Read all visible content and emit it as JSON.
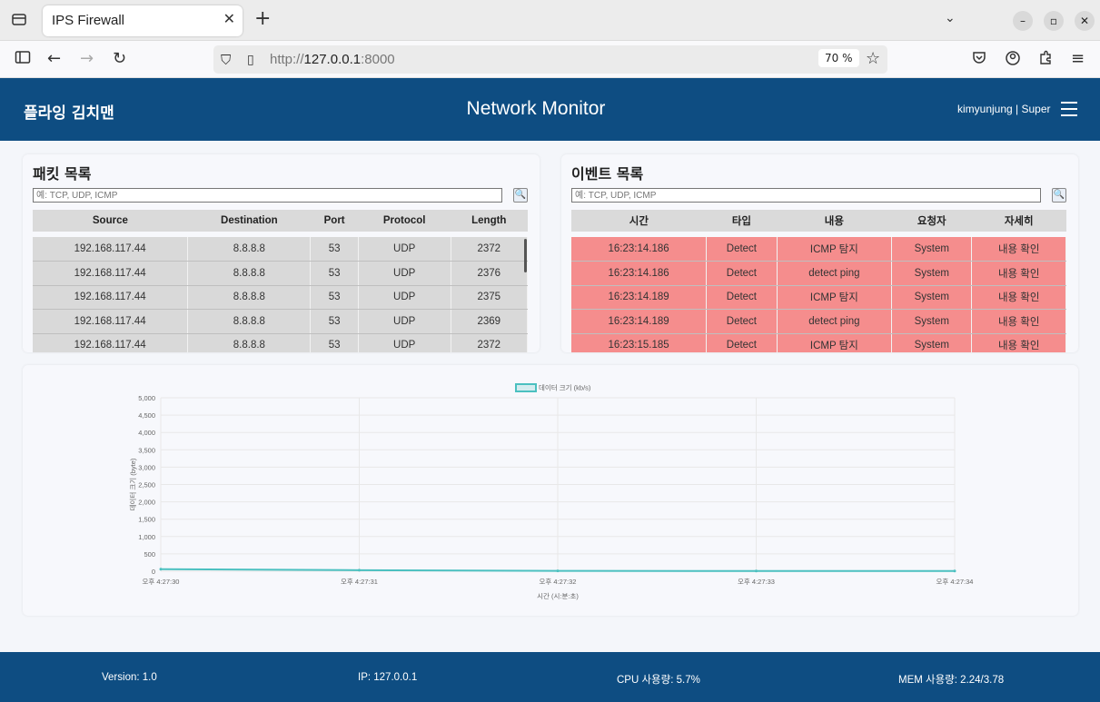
{
  "browser": {
    "tab_title": "IPS Firewall",
    "url_prefix": "http://",
    "url_host": "127.0.0.1",
    "url_port": ":8000",
    "zoom": "70 %"
  },
  "header": {
    "brand": "플라잉 김치맨",
    "title": "Network Monitor",
    "user": "kimyunjung | Super"
  },
  "packets": {
    "title": "패킷 목록",
    "placeholder": "예: TCP, UDP, ICMP",
    "columns": [
      "Source",
      "Destination",
      "Port",
      "Protocol",
      "Length"
    ],
    "rows": [
      [
        "192.168.117.44",
        "8.8.8.8",
        "53",
        "UDP",
        "2372"
      ],
      [
        "192.168.117.44",
        "8.8.8.8",
        "53",
        "UDP",
        "2376"
      ],
      [
        "192.168.117.44",
        "8.8.8.8",
        "53",
        "UDP",
        "2375"
      ],
      [
        "192.168.117.44",
        "8.8.8.8",
        "53",
        "UDP",
        "2369"
      ],
      [
        "192.168.117.44",
        "8.8.8.8",
        "53",
        "UDP",
        "2372"
      ]
    ]
  },
  "events": {
    "title": "이벤트 목록",
    "placeholder": "예: TCP, UDP, ICMP",
    "columns": [
      "시간",
      "타입",
      "내용",
      "요청자",
      "자세히"
    ],
    "rows": [
      [
        "16:23:14.186",
        "Detect",
        "ICMP 탐지",
        "System",
        "내용 확인"
      ],
      [
        "16:23:14.186",
        "Detect",
        "detect ping",
        "System",
        "내용 확인"
      ],
      [
        "16:23:14.189",
        "Detect",
        "ICMP 탐지",
        "System",
        "내용 확인"
      ],
      [
        "16:23:14.189",
        "Detect",
        "detect ping",
        "System",
        "내용 확인"
      ],
      [
        "16:23:15.185",
        "Detect",
        "ICMP 탐지",
        "System",
        "내용 확인"
      ]
    ]
  },
  "chart_data": {
    "type": "line",
    "legend": "데이터 크기 (kb/s)",
    "xlabel": "시간 (시:분:초)",
    "ylabel": "데이터 크기 (byte)",
    "x": [
      "오후 4:27:30",
      "오후 4:27:31",
      "오후 4:27:32",
      "오후 4:27:33",
      "오후 4:27:34"
    ],
    "series": [
      {
        "name": "데이터 크기 (kb/s)",
        "values": [
          60,
          30,
          10,
          5,
          5
        ]
      }
    ],
    "ylim": [
      0,
      5000
    ],
    "yticks": [
      "0",
      "500",
      "1,000",
      "1,500",
      "2,000",
      "2,500",
      "3,000",
      "3,500",
      "4,000",
      "4,500",
      "5,000"
    ],
    "color": "#4bc0c0",
    "grid": true,
    "legend_position": "top"
  },
  "footer": {
    "version": "Version: 1.0",
    "ip": "IP: 127.0.0.1",
    "cpu": "CPU 사용량: 5.7%",
    "mem": "MEM 사용량: 2.24/3.78"
  }
}
